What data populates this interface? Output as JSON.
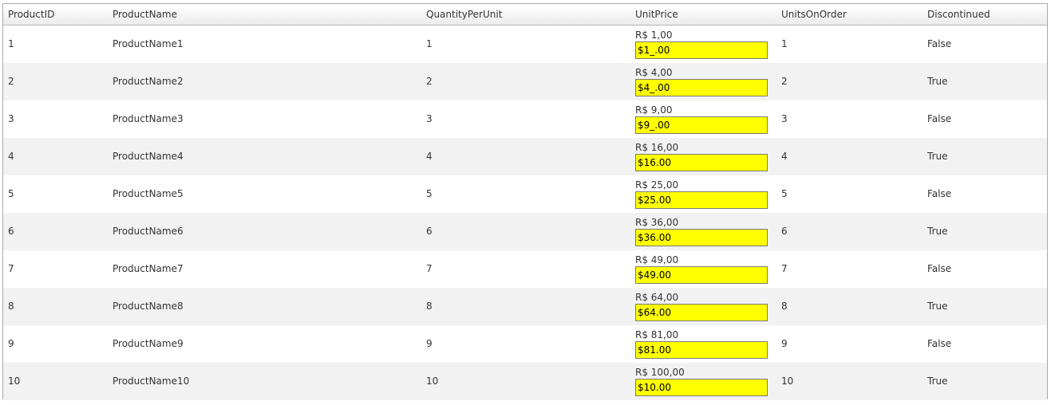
{
  "grid": {
    "columns": [
      "ProductID",
      "ProductName",
      "QuantityPerUnit",
      "UnitPrice",
      "UnitsOnOrder",
      "Discontinued"
    ],
    "rows": [
      {
        "id": "1",
        "name": "ProductName1",
        "qty": "1",
        "price_label": "R$ 1,00",
        "price_input": "$1_.00",
        "units": "1",
        "discontinued": "False"
      },
      {
        "id": "2",
        "name": "ProductName2",
        "qty": "2",
        "price_label": "R$ 4,00",
        "price_input": "$4_.00",
        "units": "2",
        "discontinued": "True"
      },
      {
        "id": "3",
        "name": "ProductName3",
        "qty": "3",
        "price_label": "R$ 9,00",
        "price_input": "$9_.00",
        "units": "3",
        "discontinued": "False"
      },
      {
        "id": "4",
        "name": "ProductName4",
        "qty": "4",
        "price_label": "R$ 16,00",
        "price_input": "$16.00",
        "units": "4",
        "discontinued": "True"
      },
      {
        "id": "5",
        "name": "ProductName5",
        "qty": "5",
        "price_label": "R$ 25,00",
        "price_input": "$25.00",
        "units": "5",
        "discontinued": "False"
      },
      {
        "id": "6",
        "name": "ProductName6",
        "qty": "6",
        "price_label": "R$ 36,00",
        "price_input": "$36.00",
        "units": "6",
        "discontinued": "True"
      },
      {
        "id": "7",
        "name": "ProductName7",
        "qty": "7",
        "price_label": "R$ 49,00",
        "price_input": "$49.00",
        "units": "7",
        "discontinued": "False"
      },
      {
        "id": "8",
        "name": "ProductName8",
        "qty": "8",
        "price_label": "R$ 64,00",
        "price_input": "$64.00",
        "units": "8",
        "discontinued": "True"
      },
      {
        "id": "9",
        "name": "ProductName9",
        "qty": "9",
        "price_label": "R$ 81,00",
        "price_input": "$81.00",
        "units": "9",
        "discontinued": "False"
      },
      {
        "id": "10",
        "name": "ProductName10",
        "qty": "10",
        "price_label": "R$ 100,00",
        "price_input": "$10.00",
        "units": "10",
        "discontinued": "True"
      }
    ]
  },
  "colors": {
    "input_highlight": "#ffff00",
    "alt_row": "#f2f2f2",
    "border": "#a9a9a9"
  }
}
